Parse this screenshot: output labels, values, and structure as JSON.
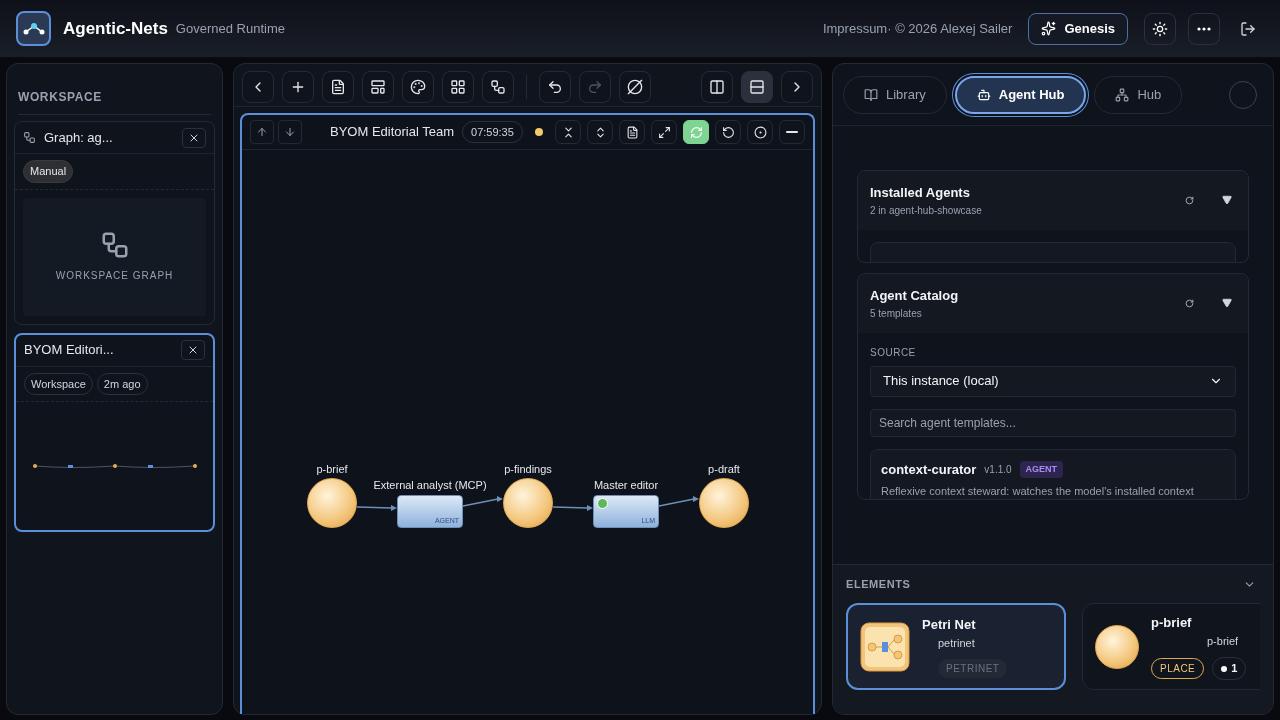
{
  "header": {
    "app_name": "Agentic-Nets",
    "subtitle": "Governed Runtime",
    "credit": "Impressum· © 2026 Alexej Sailer",
    "genesis_button": "Genesis"
  },
  "workspace": {
    "title": "WORKSPACE",
    "cards": [
      {
        "kind": "graph",
        "title": "Graph: ag...",
        "selected": false,
        "tags": [
          {
            "label": "Manual",
            "filled": true
          }
        ],
        "preview_label": "WORKSPACE GRAPH"
      },
      {
        "kind": "net",
        "title": "BYOM Editori...",
        "selected": true,
        "tags": [
          {
            "label": "Workspace",
            "filled": false
          },
          {
            "label": "2m ago",
            "filled": false
          }
        ]
      }
    ]
  },
  "toolbar": {
    "layout_toggles": [
      {
        "selected": false
      },
      {
        "selected": true
      }
    ]
  },
  "editor": {
    "title": "BYOM Editorial Team",
    "time": "07:59:35",
    "status": {
      "color": "#f5c96a"
    },
    "auto_sync": true,
    "nodes": [
      {
        "kind": "place",
        "label": "p-brief"
      },
      {
        "kind": "transition",
        "label": "External analyst (MCP)",
        "type": "AGENT",
        "running": false
      },
      {
        "kind": "place",
        "label": "p-findings"
      },
      {
        "kind": "transition",
        "label": "Master editor",
        "type": "LLM",
        "running": true
      },
      {
        "kind": "place",
        "label": "p-draft"
      }
    ]
  },
  "right_panel": {
    "tabs": [
      {
        "label": "Library",
        "selected": false
      },
      {
        "label": "Agent Hub",
        "selected": true
      },
      {
        "label": "Hub",
        "selected": false
      }
    ],
    "installed": {
      "title": "Installed Agents",
      "subtitle": "2 in agent-hub-showcase"
    },
    "catalog": {
      "title": "Agent Catalog",
      "subtitle": "5 templates",
      "source_label": "SOURCE",
      "source_value": "This instance (local)",
      "search_placeholder": "Search agent templates...",
      "templates": [
        {
          "name": "context-curator",
          "version": "v1.1.0",
          "badge": "AGENT",
          "description": "Reflexive context steward: watches the model's installed context"
        }
      ]
    },
    "elements": {
      "title": "ELEMENTS",
      "items": [
        {
          "kind": "net",
          "name": "Petri Net",
          "sub": "petrinet",
          "badge": "PETRINET",
          "selected": true
        },
        {
          "kind": "place",
          "name": "p-brief",
          "sub": "p-brief",
          "badge": "PLACE",
          "tokens": "1",
          "selected": false
        }
      ]
    }
  }
}
